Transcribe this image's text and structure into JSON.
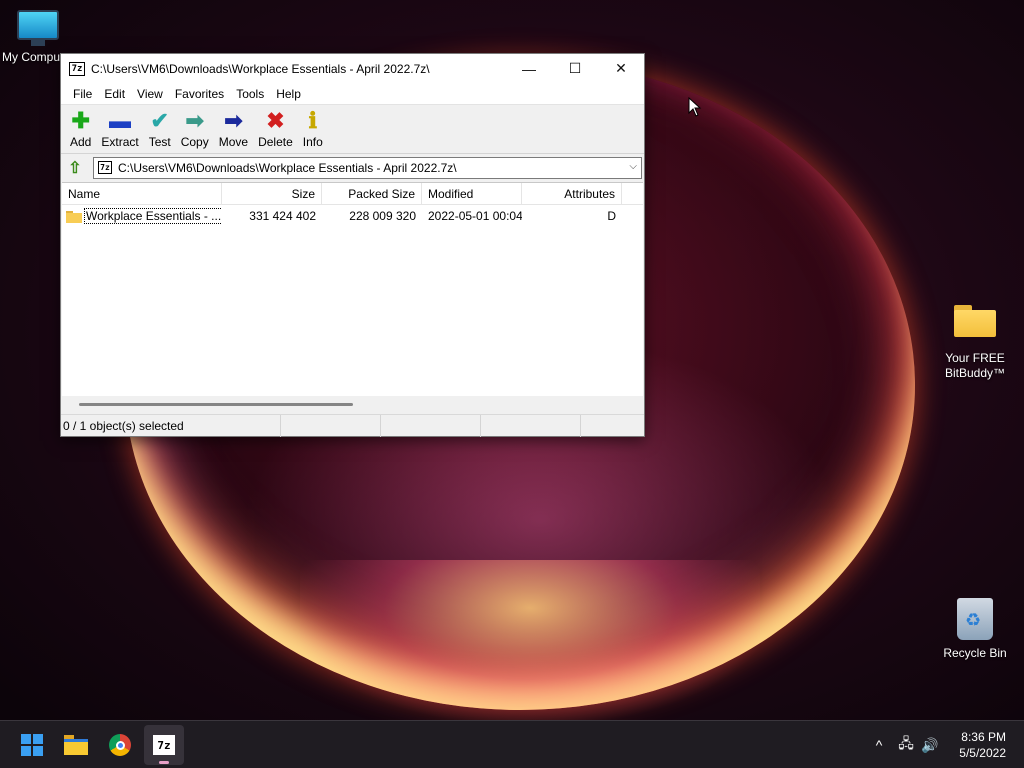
{
  "desktop": {
    "icons": [
      {
        "label": "My Compu",
        "icon": "monitor-icon"
      },
      {
        "label": "Your FREE BitBuddy™",
        "icon": "folder-icon"
      },
      {
        "label": "Recycle Bin",
        "icon": "recycle-bin-icon"
      }
    ]
  },
  "window": {
    "app_icon": "7z",
    "title": "C:\\Users\\VM6\\Downloads\\Workplace Essentials - April 2022.7z\\",
    "controls": {
      "minimize": "—",
      "maximize": "☐",
      "close": "✕"
    },
    "menu": [
      "File",
      "Edit",
      "View",
      "Favorites",
      "Tools",
      "Help"
    ],
    "toolbar": [
      {
        "label": "Add",
        "glyph": "✚",
        "color": "#1aa81a"
      },
      {
        "label": "Extract",
        "glyph": "▬",
        "color": "#1b3fc4"
      },
      {
        "label": "Test",
        "glyph": "✔",
        "color": "#2aa8a8"
      },
      {
        "label": "Copy",
        "glyph": "➡",
        "color": "#3a9a8a"
      },
      {
        "label": "Move",
        "glyph": "➡",
        "color": "#1b2a9c"
      },
      {
        "label": "Delete",
        "glyph": "✖",
        "color": "#d21f1f"
      },
      {
        "label": "Info",
        "glyph": "ℹ",
        "color": "#c7a800"
      }
    ],
    "address": {
      "path": "C:\\Users\\VM6\\Downloads\\Workplace Essentials - April 2022.7z\\"
    },
    "columns": {
      "name": "Name",
      "size": "Size",
      "packed": "Packed Size",
      "modified": "Modified",
      "attributes": "Attributes"
    },
    "rows": [
      {
        "name": "Workplace Essentials - ...",
        "size": "331 424 402",
        "packed": "228 009 320",
        "modified": "2022-05-01 00:04",
        "attributes": "D"
      }
    ],
    "status": "0 / 1 object(s) selected"
  },
  "taskbar": {
    "clock_time": "8:36 PM",
    "clock_date": "5/5/2022",
    "tray_chevron": "^"
  }
}
